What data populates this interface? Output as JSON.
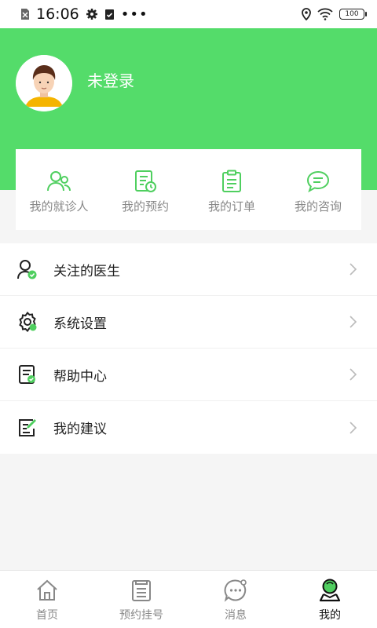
{
  "status_bar": {
    "time": "16:06",
    "battery": "100"
  },
  "profile": {
    "login_status": "未登录"
  },
  "quick_actions": [
    {
      "label": "我的就诊人",
      "icon": "patients-icon"
    },
    {
      "label": "我的预约",
      "icon": "appointment-icon"
    },
    {
      "label": "我的订单",
      "icon": "order-icon"
    },
    {
      "label": "我的咨询",
      "icon": "consult-icon"
    }
  ],
  "menu": [
    {
      "label": "关注的医生",
      "icon": "followed-doctor-icon"
    },
    {
      "label": "系统设置",
      "icon": "settings-icon"
    },
    {
      "label": "帮助中心",
      "icon": "help-center-icon"
    },
    {
      "label": "我的建议",
      "icon": "feedback-icon"
    }
  ],
  "bottom_nav": [
    {
      "label": "首页",
      "icon": "home-icon"
    },
    {
      "label": "预约挂号",
      "icon": "register-icon"
    },
    {
      "label": "消息",
      "icon": "message-icon"
    },
    {
      "label": "我的",
      "icon": "profile-icon",
      "active": true
    }
  ],
  "colors": {
    "brand_green": "#54dc6a",
    "icon_green": "#4fcf5f",
    "accent_check": "#4fcf5f"
  }
}
